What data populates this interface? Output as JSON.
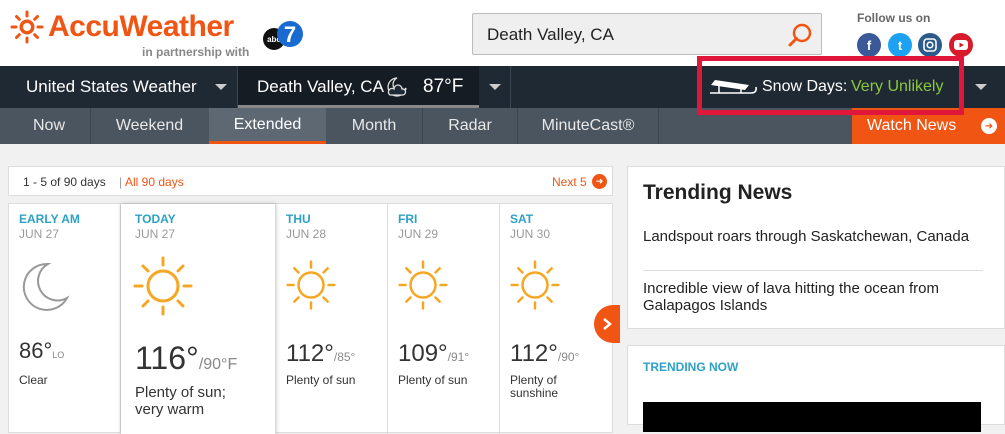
{
  "brand": {
    "name": "AccuWeather",
    "partner": "in partnership with",
    "partner_logo": "abc7"
  },
  "search": {
    "value": "Death Valley, CA"
  },
  "social": {
    "label": "Follow us on",
    "icons": [
      "facebook-icon",
      "twitter-icon",
      "instagram-icon",
      "youtube-icon"
    ]
  },
  "nav": {
    "region": "United States Weather",
    "location": "Death Valley, CA",
    "current_temp": "87°F",
    "snow_label": "Snow Days:",
    "snow_value": "Very Unlikely"
  },
  "tabs": [
    "Now",
    "Weekend",
    "Extended",
    "Month",
    "Radar",
    "MinuteCast®"
  ],
  "active_tab": "Extended",
  "watch": "Watch News",
  "pager": {
    "range": "1 - 5 of 90 days",
    "sep": "|",
    "all": "All 90 days",
    "next": "Next 5"
  },
  "forecast": [
    {
      "day": "EARLY AM",
      "date": "JUN 27",
      "hi": "86°",
      "lo": "LO",
      "desc": "Clear",
      "icon": "moon-icon"
    },
    {
      "day": "TODAY",
      "date": "JUN 27",
      "hi": "116°",
      "lo": "/90°F",
      "desc": "Plenty of sun; very warm",
      "icon": "sun-icon"
    },
    {
      "day": "THU",
      "date": "JUN 28",
      "hi": "112°",
      "lo": "/85°",
      "desc": "Plenty of sun",
      "icon": "sun-icon"
    },
    {
      "day": "FRI",
      "date": "JUN 29",
      "hi": "109°",
      "lo": "/91°",
      "desc": "Plenty of sun",
      "icon": "sun-icon"
    },
    {
      "day": "SAT",
      "date": "JUN 30",
      "hi": "112°",
      "lo": "/90°",
      "desc": "Plenty of sunshine",
      "icon": "sun-icon"
    }
  ],
  "trending": {
    "title": "Trending News",
    "items": [
      "Landspout roars through Saskatchewan, Canada",
      "Incredible view of lava hitting the ocean from Galapagos Islands"
    ],
    "now_label": "TRENDING NOW"
  },
  "colors": {
    "brand": "#f05514",
    "accent": "#2ea1c4",
    "snow_value": "#8dc63f",
    "highlight": "#e0173a"
  }
}
